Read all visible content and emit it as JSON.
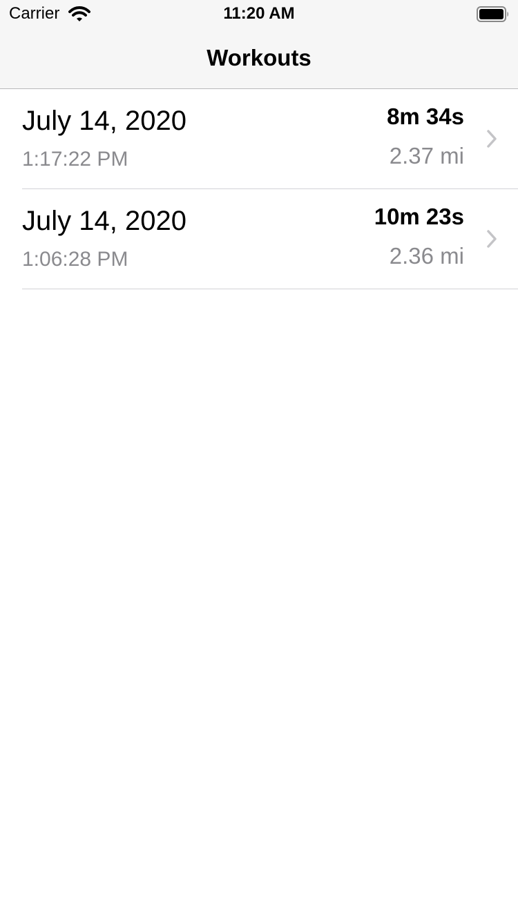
{
  "status_bar": {
    "carrier": "Carrier",
    "time": "11:20 AM",
    "wifi_icon": "wifi-icon",
    "battery_icon": "battery-icon"
  },
  "nav": {
    "title": "Workouts"
  },
  "workouts": [
    {
      "date": "July 14, 2020",
      "time": "1:17:22 PM",
      "duration": "8m 34s",
      "distance": "2.37 mi"
    },
    {
      "date": "July 14, 2020",
      "time": "1:06:28 PM",
      "duration": "10m 23s",
      "distance": "2.36 mi"
    }
  ],
  "colors": {
    "primary_text": "#000000",
    "secondary_text": "#8a8a8e",
    "separator": "#d2d2d6",
    "nav_background": "#f6f6f6",
    "chevron": "#c4c4c7"
  }
}
